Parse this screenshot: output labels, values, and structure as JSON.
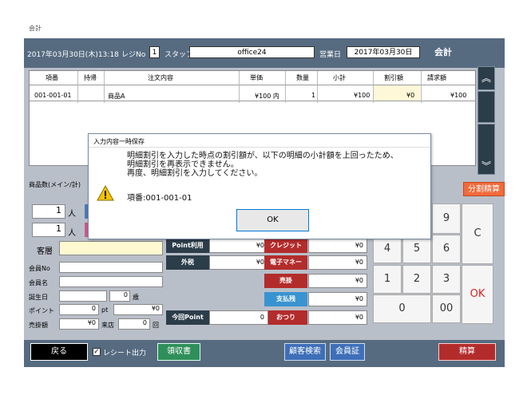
{
  "window_title": "会計",
  "topbar": {
    "datetime": "2017年03月30日(木)13:18",
    "register_label": "レジNo",
    "register_no": "1",
    "staff_label": "スタッフ",
    "staff_name": "office24",
    "bizday_label": "営業日",
    "bizday": "2017年03月30日",
    "screen_title": "会計"
  },
  "table": {
    "headers": [
      "項番",
      "持帰",
      "注文内容",
      "単価",
      "数量",
      "小計",
      "割引額",
      "請求額"
    ],
    "rows": [
      {
        "no": "001-001-01",
        "takeout": "",
        "item": "商品A",
        "price": "¥100 内",
        "qty": "1",
        "subtotal": "¥100",
        "discount": "¥0",
        "total": "¥100"
      }
    ]
  },
  "left": {
    "items_label": "商品数(メイン/計)",
    "count1": "1",
    "count2": "1",
    "person_unit": "人",
    "customer_label": "客層",
    "member_no_label": "会員No",
    "member_name_label": "会員名",
    "birthday_label": "誕生日",
    "age_value": "0",
    "age_unit": "歳",
    "point_label": "ポイント",
    "point_value": "0",
    "point_unit": "pt",
    "point_yen": "¥0",
    "sales_label": "売掛額",
    "sales_value": "¥0",
    "visit_label": "来店",
    "visit_value": "0",
    "visit_unit": "回"
  },
  "payment": {
    "point_use_label": "Point利用",
    "point_use_value": "¥0",
    "tax_label": "外税",
    "tax_value": "¥0",
    "credit_label": "クレジット",
    "credit_value": "¥0",
    "emoney_label": "電子マネー",
    "emoney_value": "¥0",
    "urikake_label": "売掛",
    "urikake_value": "¥0",
    "balance_label": "支払残",
    "balance_value": "¥0",
    "change_label": "おつり",
    "change_value": "¥0",
    "next_point_label": "今回Point",
    "next_point_value": "0"
  },
  "split_button": "分割精算",
  "keypad": [
    "9",
    "C",
    "4",
    "5",
    "6",
    "1",
    "2",
    "3",
    "OK",
    "0",
    "00"
  ],
  "bottom": {
    "back": "戻る",
    "receipt_check": "レシート出力",
    "ryoshusho": "領収書",
    "customer_search": "顧客検索",
    "member_card": "会員証",
    "settle": "精算"
  },
  "dialog": {
    "title": "入力内容一時保存",
    "line1": "明細割引を入力した時点の割引額が、以下の明細の小計額を上回ったため、",
    "line2": "明細割引を再表示できません。",
    "line3": "再度、明細割引を入力してください。",
    "code": "項番:001-001-01",
    "ok": "OK"
  }
}
